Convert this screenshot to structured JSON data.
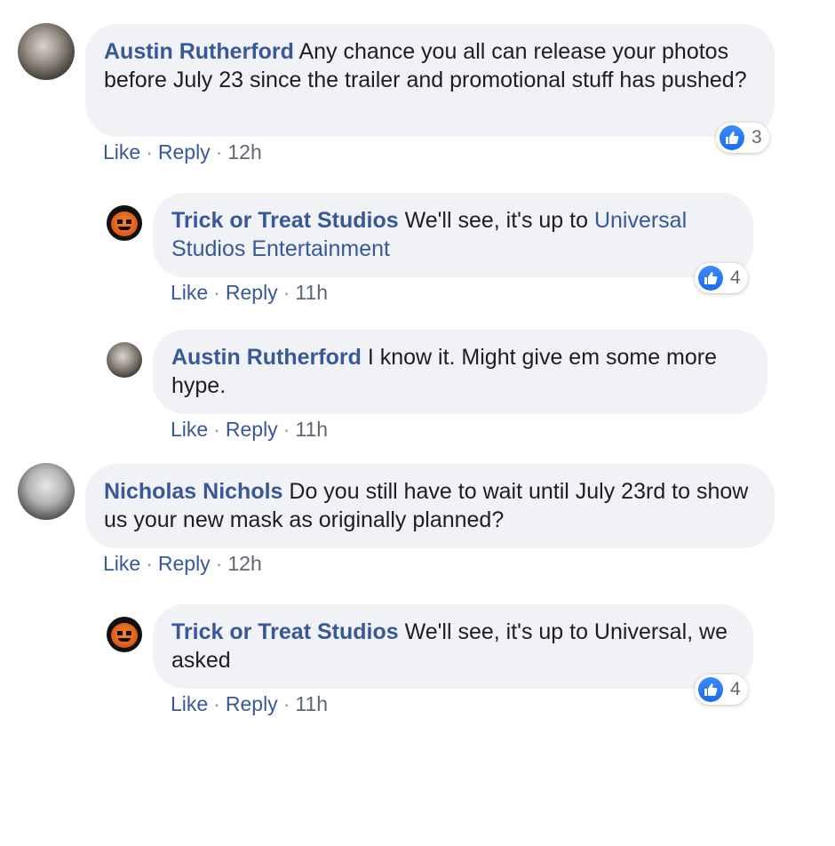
{
  "comments": [
    {
      "author": "Austin Rutherford",
      "text": "Any chance you all can release your photos before July 23 since the trailer and promotional stuff has pushed?",
      "like": "Like",
      "reply": "Reply",
      "time": "12h",
      "reactions": "3",
      "avatar_icon": "michael-myers-avatar"
    },
    {
      "author": "Trick or Treat Studios",
      "text_before": "We'll see, it's up to ",
      "link": "Universal Studios Entertainment",
      "like": "Like",
      "reply": "Reply",
      "time": "11h",
      "reactions": "4",
      "avatar_icon": "pumpkin-avatar"
    },
    {
      "author": "Austin Rutherford",
      "text": "I know it. Might give em some more hype.",
      "like": "Like",
      "reply": "Reply",
      "time": "11h",
      "avatar_icon": "michael-myers-avatar"
    },
    {
      "author": "Nicholas Nichols",
      "text": "Do you still have to wait until July 23rd to show us your new mask as originally planned?",
      "like": "Like",
      "reply": "Reply",
      "time": "12h",
      "avatar_icon": "person-avatar"
    },
    {
      "author": "Trick or Treat Studios",
      "text": "We'll see, it's up to Universal, we asked",
      "like": "Like",
      "reply": "Reply",
      "time": "11h",
      "reactions": "4",
      "avatar_icon": "pumpkin-avatar"
    }
  ],
  "separator": "·",
  "colors": {
    "link": "#385898",
    "bubble": "#f0f2f5",
    "like_blue": "#1a6cf0"
  }
}
